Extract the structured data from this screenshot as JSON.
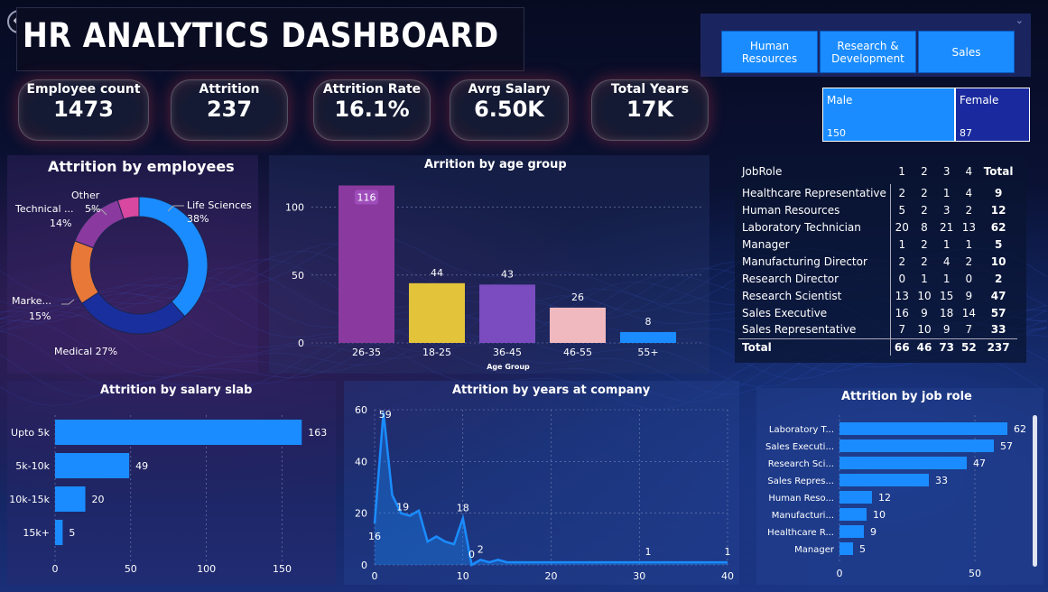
{
  "title": "HR ANALYTICS DASHBOARD",
  "department_slicer": {
    "buttons": [
      "Human Resources",
      "Research & Development",
      "Sales"
    ]
  },
  "kpis": [
    {
      "label": "Employee count",
      "value": "1473"
    },
    {
      "label": "Attrition",
      "value": "237"
    },
    {
      "label": "Attrition Rate",
      "value": "16.1%"
    },
    {
      "label": "Avrg Salary",
      "value": "6.50K"
    },
    {
      "label": "Total Years",
      "value": "17K"
    }
  ],
  "gender": [
    {
      "label": "Male",
      "count": "150"
    },
    {
      "label": "Female",
      "count": "87"
    }
  ],
  "colors": {
    "blue": "#1a8cff",
    "dark_blue": "#1a2f9e",
    "purple": "#8a3a9e",
    "yellow": "#e2c33a",
    "violet": "#7a4cc0",
    "pink": "#f0b8bf",
    "orange": "#e87838",
    "magenta": "#d848a0"
  },
  "chart_data": [
    {
      "type": "pie",
      "title": "Attrition by employees",
      "labels": [
        "Life Sciences",
        "Medical",
        "Marke...",
        "Technical ...",
        "Other"
      ],
      "values": [
        38,
        27,
        15,
        14,
        5
      ],
      "value_labels": [
        "38%",
        "27%",
        "15%",
        "14%",
        "5%"
      ]
    },
    {
      "type": "bar",
      "title": "Arrition by age group",
      "xlabel": "Age Group",
      "categories": [
        "26-35",
        "18-25",
        "36-45",
        "46-55",
        "55+"
      ],
      "values": [
        116,
        44,
        43,
        26,
        8
      ],
      "ylim": [
        0,
        125
      ],
      "yticks": [
        0,
        50,
        100
      ]
    },
    {
      "type": "table",
      "title": "JobRole",
      "columns": [
        "JobRole",
        "1",
        "2",
        "3",
        "4",
        "Total"
      ],
      "rows": [
        [
          "Healthcare Representative",
          "2",
          "2",
          "1",
          "4",
          "9"
        ],
        [
          "Human Resources",
          "5",
          "2",
          "3",
          "2",
          "12"
        ],
        [
          "Laboratory Technician",
          "20",
          "8",
          "21",
          "13",
          "62"
        ],
        [
          "Manager",
          "1",
          "2",
          "1",
          "1",
          "5"
        ],
        [
          "Manufacturing Director",
          "2",
          "2",
          "4",
          "2",
          "10"
        ],
        [
          "Research Director",
          "0",
          "1",
          "1",
          "0",
          "2"
        ],
        [
          "Research Scientist",
          "13",
          "10",
          "15",
          "9",
          "47"
        ],
        [
          "Sales Executive",
          "16",
          "9",
          "18",
          "14",
          "57"
        ],
        [
          "Sales Representative",
          "7",
          "10",
          "9",
          "7",
          "33"
        ]
      ],
      "total_row": [
        "Total",
        "66",
        "46",
        "73",
        "52",
        "237"
      ]
    },
    {
      "type": "bar",
      "orientation": "horizontal",
      "title": "Attrition by salary slab",
      "categories": [
        "Upto 5k",
        "5k-10k",
        "10k-15k",
        "15k+"
      ],
      "values": [
        163,
        49,
        20,
        5
      ],
      "xlim": [
        0,
        170
      ],
      "xticks": [
        0,
        50,
        100,
        150
      ]
    },
    {
      "type": "area",
      "title": "Attrition by years at company",
      "x": [
        0,
        1,
        2,
        3,
        4,
        5,
        6,
        7,
        8,
        9,
        10,
        11,
        12,
        13,
        14,
        15,
        16,
        17,
        18,
        19,
        20,
        21,
        22,
        23,
        24,
        25,
        26,
        27,
        28,
        29,
        30,
        31,
        32,
        33,
        34,
        35,
        36,
        37,
        38,
        39,
        40
      ],
      "y": [
        16,
        59,
        27,
        20,
        19,
        21,
        9,
        11,
        9,
        8,
        18,
        0,
        2,
        1,
        2,
        1,
        1,
        1,
        1,
        1,
        1,
        1,
        1,
        1,
        1,
        1,
        1,
        1,
        1,
        1,
        1,
        1,
        1,
        1,
        1,
        1,
        1,
        1,
        1,
        1,
        1
      ],
      "point_labels": [
        {
          "x": 0,
          "y": 16,
          "text": "16"
        },
        {
          "x": 1,
          "y": 59,
          "text": "59"
        },
        {
          "x": 4,
          "y": 19,
          "text": "19"
        },
        {
          "x": 10,
          "y": 18,
          "text": "18"
        },
        {
          "x": 11,
          "y": 0,
          "text": "0"
        },
        {
          "x": 12,
          "y": 2,
          "text": "2"
        },
        {
          "x": 31,
          "y": 1,
          "text": "1"
        },
        {
          "x": 40,
          "y": 1,
          "text": "1"
        }
      ],
      "xlim": [
        0,
        40
      ],
      "ylim": [
        0,
        60
      ],
      "xticks": [
        0,
        10,
        20,
        30,
        40
      ],
      "yticks": [
        0,
        20,
        40,
        60
      ]
    },
    {
      "type": "bar",
      "orientation": "horizontal",
      "title": "Attrition by job role",
      "categories": [
        "Laboratory T...",
        "Sales Executi...",
        "Research Sci...",
        "Sales Repres...",
        "Human Reso...",
        "Manufacturi...",
        "Healthcare R...",
        "Manager"
      ],
      "values": [
        62,
        57,
        47,
        33,
        12,
        10,
        9,
        5
      ],
      "xlim": [
        0,
        65
      ],
      "xticks": [
        0,
        50
      ]
    }
  ]
}
